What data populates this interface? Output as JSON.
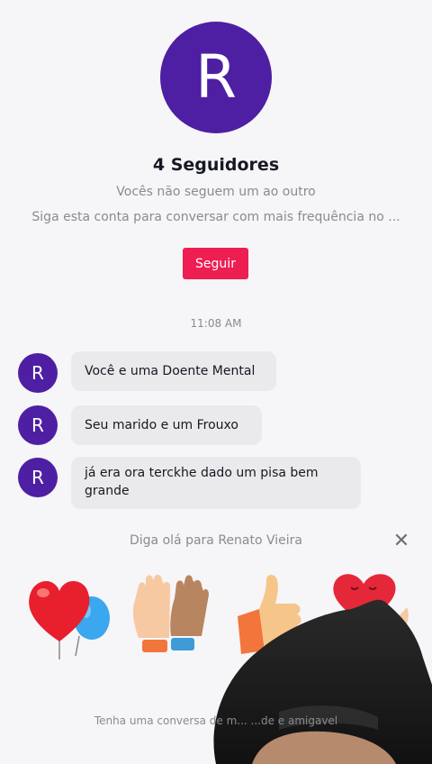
{
  "profile": {
    "avatar_letter": "R",
    "followers": "4 Seguidores",
    "mutual_status": "Vocês não seguem um ao outro",
    "follow_hint": "Siga esta conta para conversar com mais frequência no ...",
    "follow_button": "Seguir"
  },
  "chat": {
    "timestamp": "11:08 AM",
    "messages": [
      {
        "avatar_letter": "R",
        "text": "Você e uma Doente Mental"
      },
      {
        "avatar_letter": "R",
        "text": "Seu marido e um Frouxo"
      },
      {
        "avatar_letter": "R",
        "text": "já era ora terckhe dado um pisa bem grande"
      }
    ]
  },
  "greeting": {
    "text": "Diga olá para Renato Vieira",
    "close_icon": "close-icon",
    "stickers": [
      "heart-balloons-sticker",
      "high-five-hands-sticker",
      "thumbs-up-sticker",
      "heart-in-hand-sticker"
    ]
  },
  "footer": {
    "tagline": "Tenha uma conversa de m... ...de e amigavel"
  },
  "colors": {
    "avatar": "#4e1fa3",
    "follow_button": "#ee1d52",
    "bubble": "#eaeaec",
    "background": "#f6f5f7"
  }
}
